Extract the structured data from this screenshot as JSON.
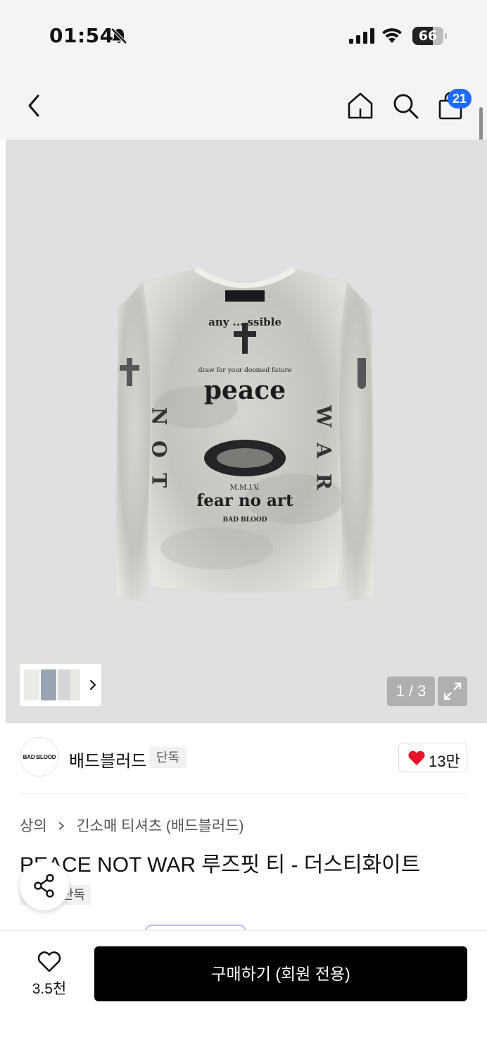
{
  "status_bar": {
    "time": "01:54",
    "battery": "66",
    "battery_percent": 66,
    "icons": [
      "bell-off-icon",
      "signal-icon",
      "wifi-icon",
      "battery-icon"
    ]
  },
  "nav": {
    "cart_count": "21",
    "icons": [
      "back-icon",
      "home-icon",
      "search-icon",
      "bag-icon"
    ]
  },
  "hero": {
    "page_indicator": "1 / 3",
    "shirt_print": {
      "collar_text": "any ... ssible",
      "line1": "draw for your doomed future",
      "line2": "peace",
      "line3": "M.M.I.V.",
      "line4": "fear no art",
      "line5": "BAD BLOOD",
      "sleeve_left": "N O T",
      "sleeve_right": "W A R"
    }
  },
  "brand": {
    "logo_text": "BAD BLOOD",
    "name": "배드블러드",
    "tag": "단독",
    "likes": "13만"
  },
  "product": {
    "breadcrumb": [
      "상의",
      "긴소매 티셔츠 (배드블러드)"
    ],
    "title": "PEACE NOT WAR 루즈핏 티 - 더스티화이트",
    "tag": "단독"
  },
  "bottom_bar": {
    "wish_count": "3.5천",
    "buy_label": "구매하기 (회원 전용)"
  },
  "colors": {
    "accent_blue": "#1f6bff",
    "heart_red": "#e8142b",
    "buy_black": "#000000",
    "nav_bg": "#f4f4f4",
    "hero_bg": "#e0e0e0"
  }
}
